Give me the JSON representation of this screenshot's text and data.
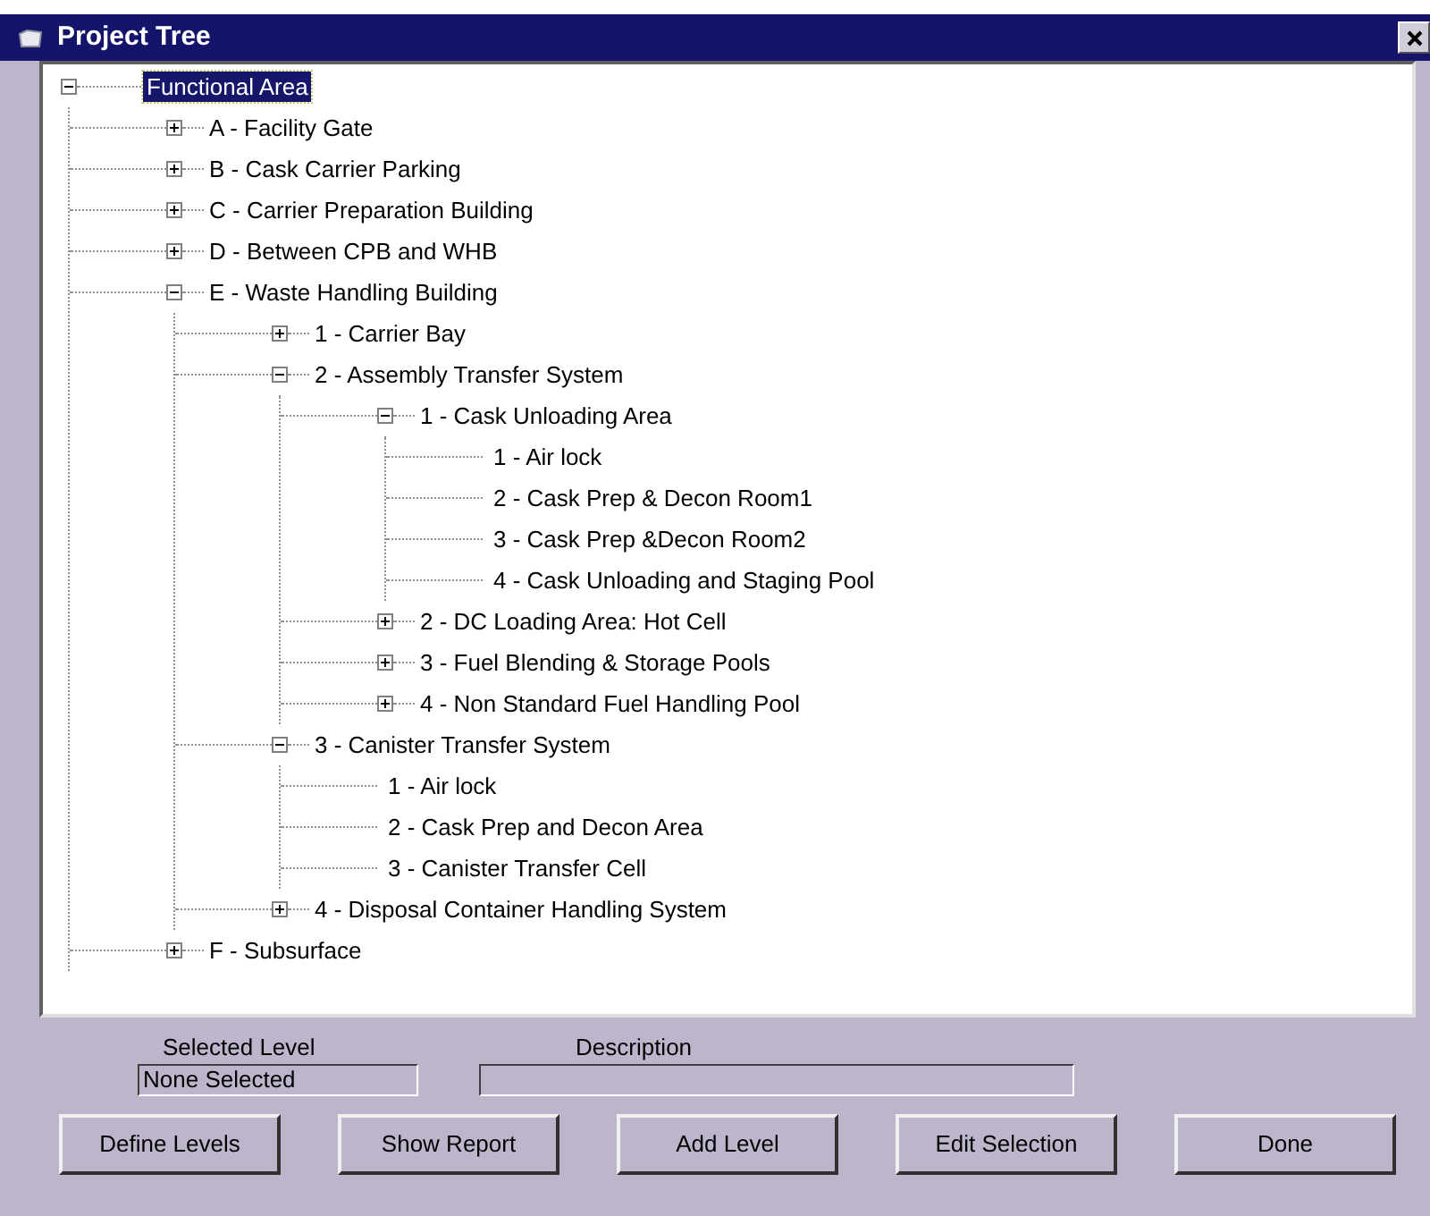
{
  "window": {
    "title": "Project Tree"
  },
  "tree": {
    "label": "Functional Area",
    "selected": true,
    "expanded": true,
    "children": [
      {
        "label": "A - Facility Gate",
        "expanded": false
      },
      {
        "label": "B - Cask Carrier Parking",
        "expanded": false
      },
      {
        "label": "C - Carrier Preparation Building",
        "expanded": false
      },
      {
        "label": "D - Between CPB and WHB",
        "expanded": false
      },
      {
        "label": "E - Waste Handling Building",
        "expanded": true,
        "children": [
          {
            "label": "1 - Carrier Bay",
            "expanded": false
          },
          {
            "label": "2 - Assembly Transfer System",
            "expanded": true,
            "children": [
              {
                "label": "1 - Cask Unloading Area",
                "expanded": true,
                "children": [
                  {
                    "label": "1 - Air lock"
                  },
                  {
                    "label": "2 - Cask Prep & Decon Room1"
                  },
                  {
                    "label": "3 - Cask Prep &Decon Room2"
                  },
                  {
                    "label": "4 - Cask Unloading and Staging Pool"
                  }
                ]
              },
              {
                "label": "2 - DC Loading Area: Hot Cell",
                "expanded": false
              },
              {
                "label": "3 - Fuel Blending & Storage Pools",
                "expanded": false
              },
              {
                "label": "4 - Non Standard Fuel Handling Pool",
                "expanded": false
              }
            ]
          },
          {
            "label": "3 - Canister Transfer System",
            "expanded": true,
            "children": [
              {
                "label": "1 - Air lock"
              },
              {
                "label": "2 - Cask Prep and Decon Area"
              },
              {
                "label": "3 - Canister Transfer Cell"
              }
            ]
          },
          {
            "label": "4 - Disposal Container Handling System",
            "expanded": false
          }
        ]
      },
      {
        "label": "F - Subsurface",
        "expanded": false
      }
    ]
  },
  "selected_level": {
    "label": "Selected Level",
    "value": "None Selected"
  },
  "description": {
    "label": "Description"
  },
  "buttons": [
    "Define Levels",
    "Show Report",
    "Add Level",
    "Edit Selection",
    "Done"
  ]
}
